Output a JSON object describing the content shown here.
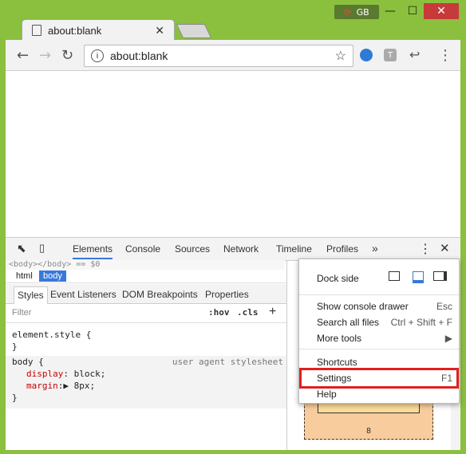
{
  "window": {
    "language_badge": "GB",
    "minimize": "—",
    "maximize": "☐",
    "close": "✕"
  },
  "tab": {
    "title": "about:blank",
    "close": "✕"
  },
  "toolbar": {
    "back": "←",
    "forward": "→",
    "reload": "↻",
    "url": "about:blank",
    "star": "☆",
    "menu": "⋮",
    "ext_t": "T",
    "reply": "↩"
  },
  "devtools": {
    "tabs": [
      "Elements",
      "Console",
      "Sources",
      "Network",
      "Timeline",
      "Profiles",
      "»"
    ],
    "breadcrumb_line": "<body></body> == $0",
    "path": [
      "html",
      "body"
    ],
    "subtabs": [
      "Styles",
      "Event Listeners",
      "DOM Breakpoints",
      "Properties"
    ],
    "filter_placeholder": "Filter",
    "hov": ":hov",
    "cls": ".cls",
    "plus": "+",
    "rules": {
      "element_style_open": "element.style {",
      "close": "}",
      "body_open": "body {",
      "ua_label": "user agent stylesheet",
      "display_prop": "display",
      "display_val": "block;",
      "margin_prop": "margin",
      "margin_val": "8px;"
    },
    "box": {
      "dash": "–",
      "value": "8"
    }
  },
  "menu": {
    "dock_side": "Dock side",
    "show_console": "Show console drawer",
    "show_console_key": "Esc",
    "search_files": "Search all files",
    "search_files_key": "Ctrl + Shift + F",
    "more_tools": "More tools",
    "more_tools_arrow": "▶",
    "shortcuts": "Shortcuts",
    "settings": "Settings",
    "settings_key": "F1",
    "help": "Help"
  }
}
